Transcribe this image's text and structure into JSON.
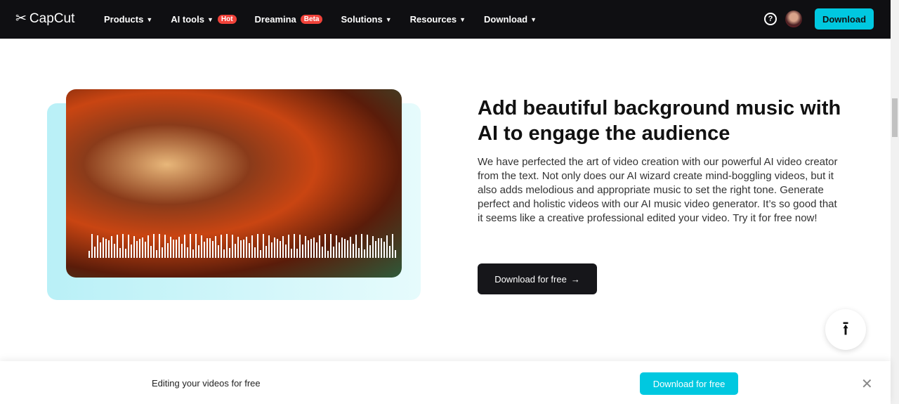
{
  "nav": {
    "brand": "CapCut",
    "items": [
      {
        "label": "Products"
      },
      {
        "label": "AI tools",
        "badge": "Hot"
      },
      {
        "label": "Dreamina",
        "badge": "Beta",
        "nochev": true
      },
      {
        "label": "Solutions"
      },
      {
        "label": "Resources"
      },
      {
        "label": "Download"
      }
    ],
    "help": "?",
    "download": "Download"
  },
  "hero": {
    "title": "Add beautiful background music with AI to engage the audience",
    "description": "We have perfected the art of video creation with our powerful AI video creator from the text. Not only does our AI wizard create mind-boggling videos, but it also adds melodious and appropriate music to set the right tone. Generate perfect and holistic videos with our AI music video generator. It’s so good that it seems like a creative professional edited your video. Try it for free now!",
    "cta": "Download for free",
    "cta_icon": "→"
  },
  "back_to_top": "⭱",
  "banner": {
    "text": "Editing your videos for free",
    "button": "Download for free",
    "close": "✕"
  },
  "colors": {
    "accent": "#00c8e0",
    "badge": "#f0423a",
    "nav_bg": "#0f0f12"
  }
}
